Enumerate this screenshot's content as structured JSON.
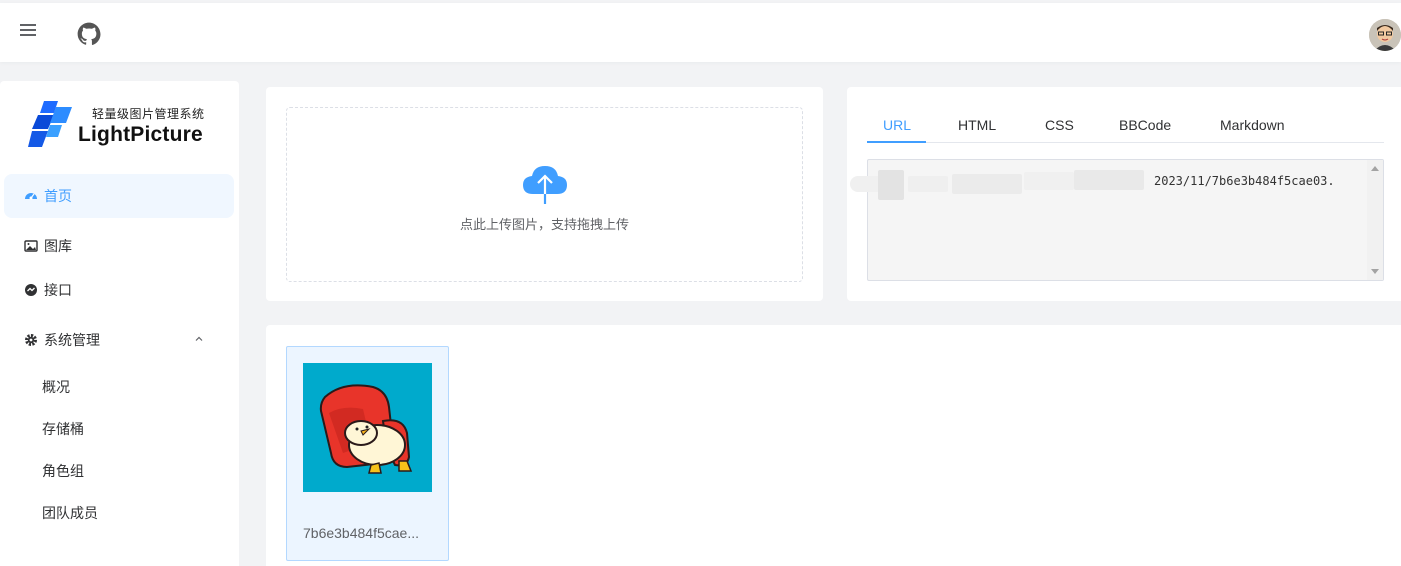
{
  "header": {
    "menu_icon": "hamburger-icon",
    "github_icon": "github-icon",
    "avatar_icon": "user-avatar"
  },
  "sidebar": {
    "logo": {
      "subtitle": "轻量级图片管理系统",
      "name": "LightPicture"
    },
    "items": [
      {
        "label": "首页",
        "icon": "dashboard-icon",
        "active": true
      },
      {
        "label": "图库",
        "icon": "image-icon",
        "active": false
      },
      {
        "label": "接口",
        "icon": "api-icon",
        "active": false
      },
      {
        "label": "系统管理",
        "icon": "gear-icon",
        "active": false,
        "expanded": true
      }
    ],
    "sub_items": [
      {
        "label": "概况"
      },
      {
        "label": "存储桶"
      },
      {
        "label": "角色组"
      },
      {
        "label": "团队成员"
      }
    ]
  },
  "upload": {
    "icon": "cloud-upload-icon",
    "hint": "点此上传图片，支持拖拽上传"
  },
  "link_panel": {
    "tabs": [
      {
        "label": "URL",
        "active": true
      },
      {
        "label": "HTML",
        "active": false
      },
      {
        "label": "CSS",
        "active": false
      },
      {
        "label": "BBCode",
        "active": false
      },
      {
        "label": "Markdown",
        "active": false
      }
    ],
    "value": "2023/11/7b6e3b484f5cae03."
  },
  "gallery": {
    "items": [
      {
        "name": "7b6e3b484f5cae..."
      }
    ]
  },
  "colors": {
    "accent": "#409eff",
    "background": "#f2f3f5",
    "active_bg": "#f0f7ff",
    "tile_bg": "#ecf5ff",
    "thumb_bg": "#00aacc"
  }
}
